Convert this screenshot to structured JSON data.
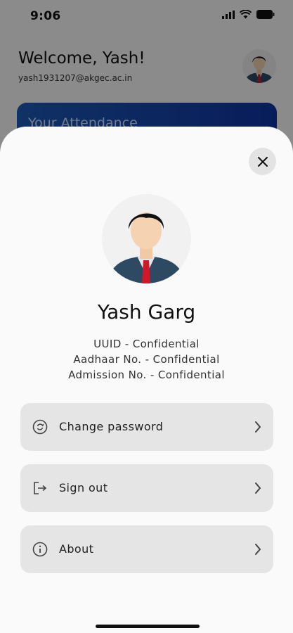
{
  "status_bar": {
    "time": "9:06"
  },
  "background": {
    "welcome": "Welcome, Yash!",
    "email": "yash1931207@akgec.ac.in",
    "attendance_title": "Your Attendance"
  },
  "profile": {
    "name": "Yash Garg",
    "uuid": "UUID - Confidential",
    "aadhaar": "Aadhaar No. - Confidential",
    "admission": "Admission No. - Confidential"
  },
  "menu": [
    {
      "label": "Change password",
      "icon": "lock-reset-icon"
    },
    {
      "label": "Sign out",
      "icon": "sign-out-icon"
    },
    {
      "label": "About",
      "icon": "info-icon"
    }
  ],
  "colors": {
    "sheet_bg": "#fafafa",
    "menu_bg": "#e5e5e5",
    "attendance_card": "#1e5bb8",
    "tie": "#d0182a",
    "suit": "#2e4a63"
  }
}
